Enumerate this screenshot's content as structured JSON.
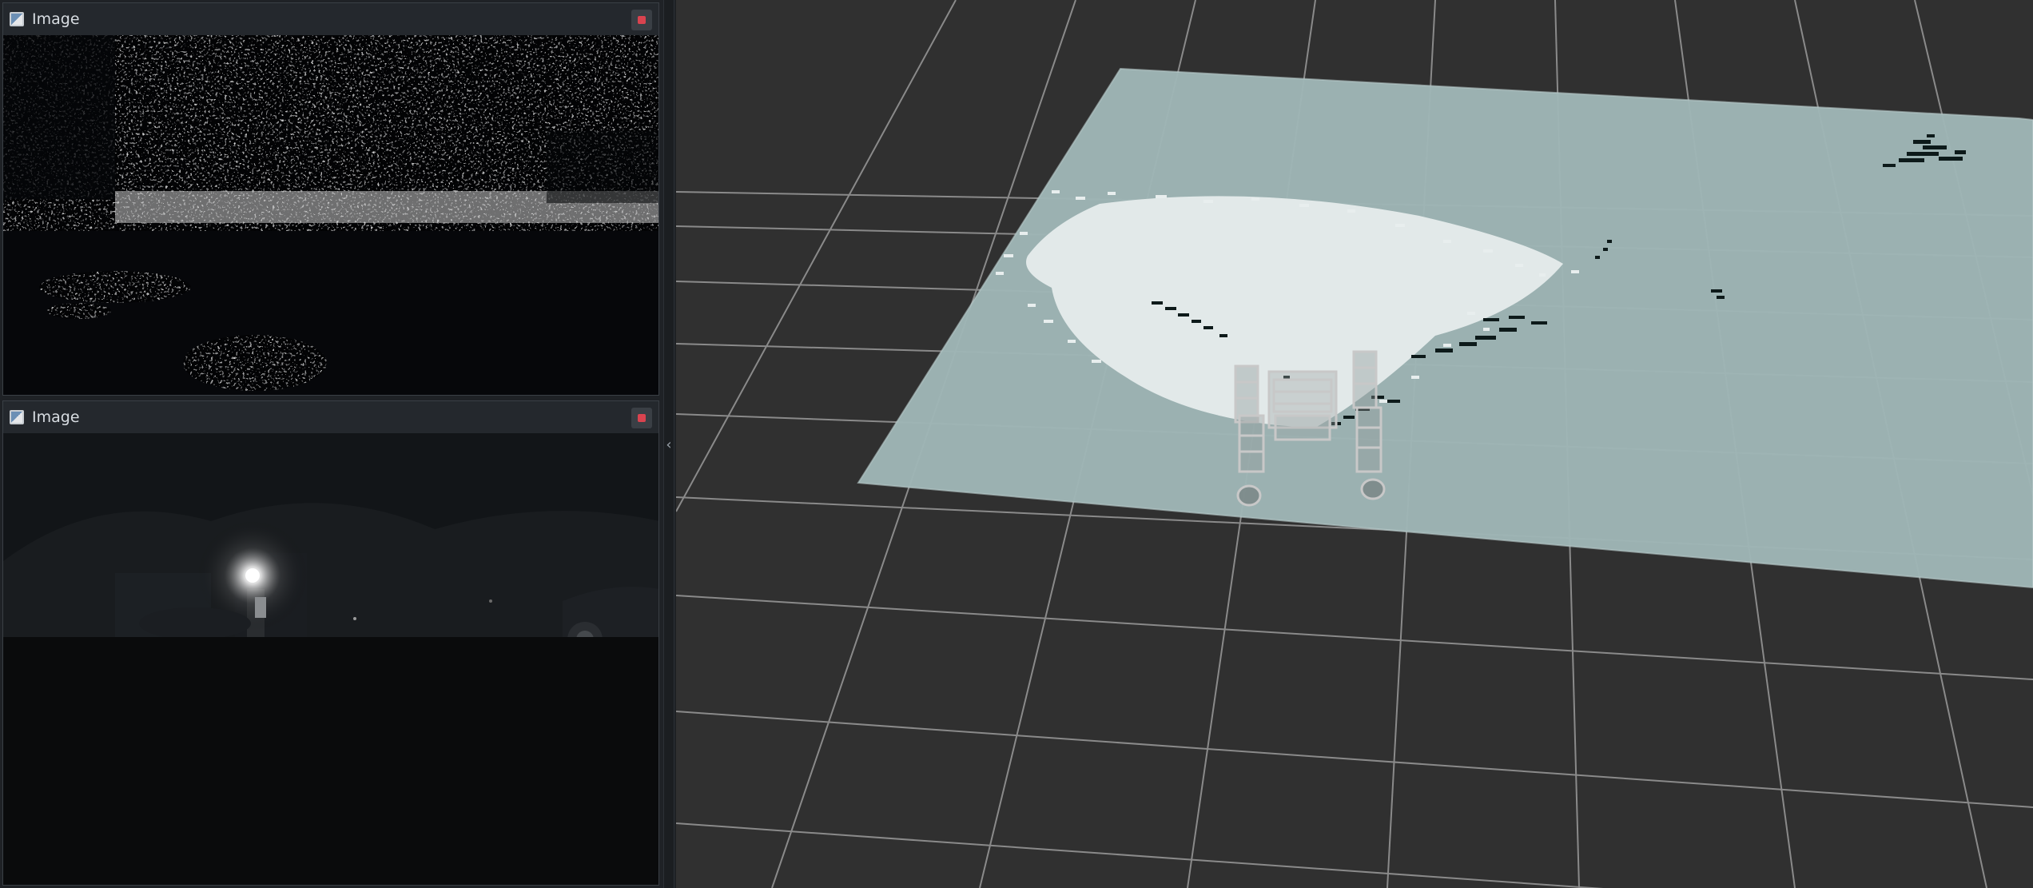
{
  "panels": {
    "top": {
      "title": "Image"
    },
    "bottom": {
      "title": "Image"
    }
  },
  "icons": {
    "panel": "image-icon",
    "close": "close-icon",
    "splitter": "chevron-left-icon"
  },
  "splitter": {
    "glyph": "‹"
  },
  "colors": {
    "viewport_bg": "#303030",
    "grid": "#9a9a9a",
    "map_plane": "#9fb6b6",
    "map_free": "#e6ecec",
    "map_obstacle": "#0d1a1a",
    "robot": "#c8c8c8",
    "close_button": "#d9434f"
  }
}
